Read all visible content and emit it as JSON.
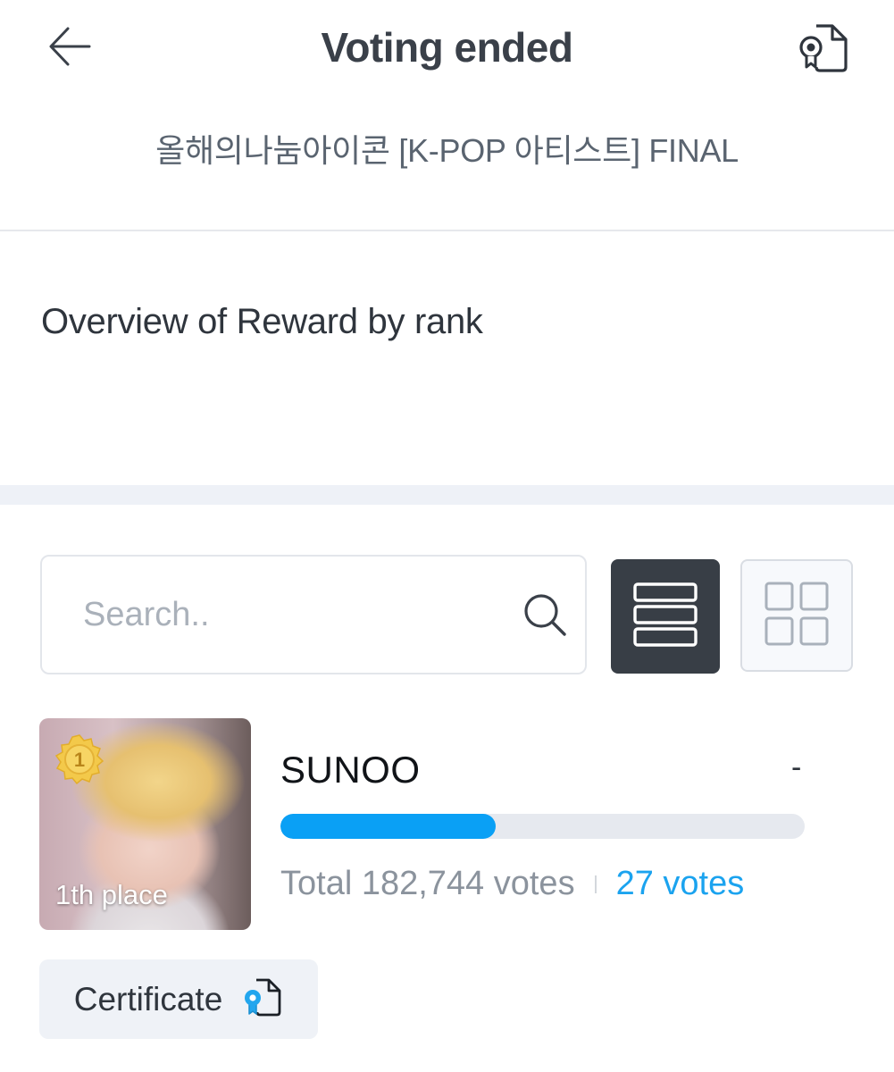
{
  "header": {
    "title": "Voting ended",
    "subtitle": "올해의나눔아이콘 [K-POP 아티스트] FINAL",
    "back_icon": "arrow-left-icon",
    "certificate_icon": "certificate-icon"
  },
  "reward_section": {
    "title": "Overview of Reward by rank"
  },
  "search": {
    "placeholder": "Search..",
    "value": ""
  },
  "view_toggle": {
    "active": "list",
    "options": [
      "list",
      "grid"
    ]
  },
  "candidates": [
    {
      "rank_badge": "1",
      "place_label": "1th place",
      "name": "SUNOO",
      "change": "-",
      "progress_percent": 41,
      "total_votes": "Total 182,744 votes",
      "my_votes": "27 votes",
      "certificate_label": "Certificate"
    }
  ],
  "colors": {
    "accent": "#0aa0f5",
    "dark_button": "#383e46",
    "medal": "#f3c94a"
  }
}
